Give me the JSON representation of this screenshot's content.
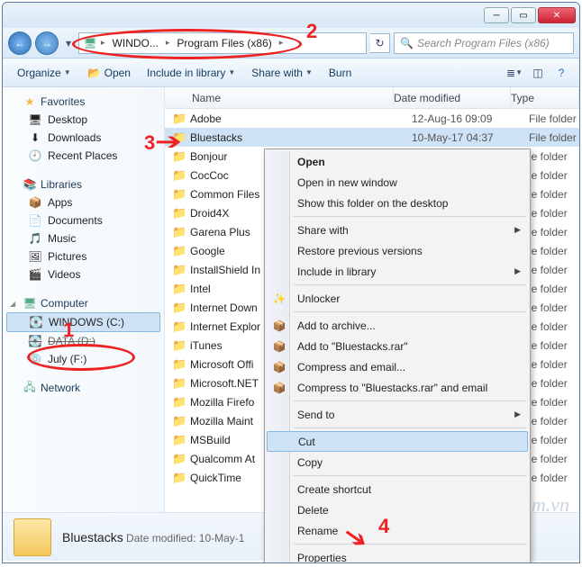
{
  "breadcrumb": {
    "seg1": "WINDO...",
    "seg2": "Program Files (x86)"
  },
  "search": {
    "placeholder": "Search Program Files (x86)"
  },
  "toolbar": {
    "organize": "Organize",
    "open": "Open",
    "include": "Include in library",
    "share": "Share with",
    "burn": "Burn"
  },
  "columns": {
    "name": "Name",
    "date": "Date modified",
    "type": "Type"
  },
  "sidebar": {
    "favorites": "Favorites",
    "fav_items": {
      "0": "Desktop",
      "1": "Downloads",
      "2": "Recent Places"
    },
    "libraries": "Libraries",
    "lib_items": {
      "0": "Apps",
      "1": "Documents",
      "2": "Music",
      "3": "Pictures",
      "4": "Videos"
    },
    "computer": "Computer",
    "comp_items": {
      "0": "WINDOWS (C:)",
      "1": "DATA (D:)",
      "2": "July (F:)"
    },
    "network": "Network"
  },
  "files": {
    "0": {
      "n": "Adobe",
      "d": "12-Aug-16 09:09",
      "t": "File folder"
    },
    "1": {
      "n": "Bluestacks",
      "d": "10-May-17 04:37",
      "t": "File folder"
    },
    "2": {
      "n": "Bonjour",
      "d": "",
      "t": "le folder"
    },
    "3": {
      "n": "CocCoc",
      "d": "",
      "t": "le folder"
    },
    "4": {
      "n": "Common Files",
      "d": "",
      "t": "le folder"
    },
    "5": {
      "n": "Droid4X",
      "d": "",
      "t": "le folder"
    },
    "6": {
      "n": "Garena Plus",
      "d": "",
      "t": "le folder"
    },
    "7": {
      "n": "Google",
      "d": "",
      "t": "le folder"
    },
    "8": {
      "n": "InstallShield In",
      "d": "",
      "t": "le folder"
    },
    "9": {
      "n": "Intel",
      "d": "",
      "t": "le folder"
    },
    "10": {
      "n": "Internet Down",
      "d": "",
      "t": "le folder"
    },
    "11": {
      "n": "Internet Explor",
      "d": "",
      "t": "le folder"
    },
    "12": {
      "n": "iTunes",
      "d": "",
      "t": "le folder"
    },
    "13": {
      "n": "Microsoft Offi",
      "d": "",
      "t": "le folder"
    },
    "14": {
      "n": "Microsoft.NET",
      "d": "",
      "t": "le folder"
    },
    "15": {
      "n": "Mozilla Firefo",
      "d": "",
      "t": "le folder"
    },
    "16": {
      "n": "Mozilla Maint",
      "d": "",
      "t": "le folder"
    },
    "17": {
      "n": "MSBuild",
      "d": "",
      "t": "le folder"
    },
    "18": {
      "n": "Qualcomm At",
      "d": "",
      "t": "le folder"
    },
    "19": {
      "n": "QuickTime",
      "d": "",
      "t": "le folder"
    }
  },
  "details": {
    "name": "Bluestacks",
    "meta_label": "Date modified:",
    "meta_value": "10-May-1"
  },
  "ctx": {
    "open": "Open",
    "opennew": "Open in new window",
    "showdesk": "Show this folder on the desktop",
    "sharewith": "Share with",
    "restore": "Restore previous versions",
    "includelib": "Include in library",
    "unlocker": "Unlocker",
    "addarchive": "Add to archive...",
    "addrar": "Add to \"Bluestacks.rar\"",
    "compemail": "Compress and email...",
    "comprar": "Compress to \"Bluestacks.rar\" and email",
    "sendto": "Send to",
    "cut": "Cut",
    "copy": "Copy",
    "shortcut": "Create shortcut",
    "delete": "Delete",
    "rename": "Rename",
    "props": "Properties"
  },
  "annot": {
    "1": "1",
    "2": "2",
    "3": "3",
    "4": "4"
  },
  "watermark": "Download.com.vn"
}
